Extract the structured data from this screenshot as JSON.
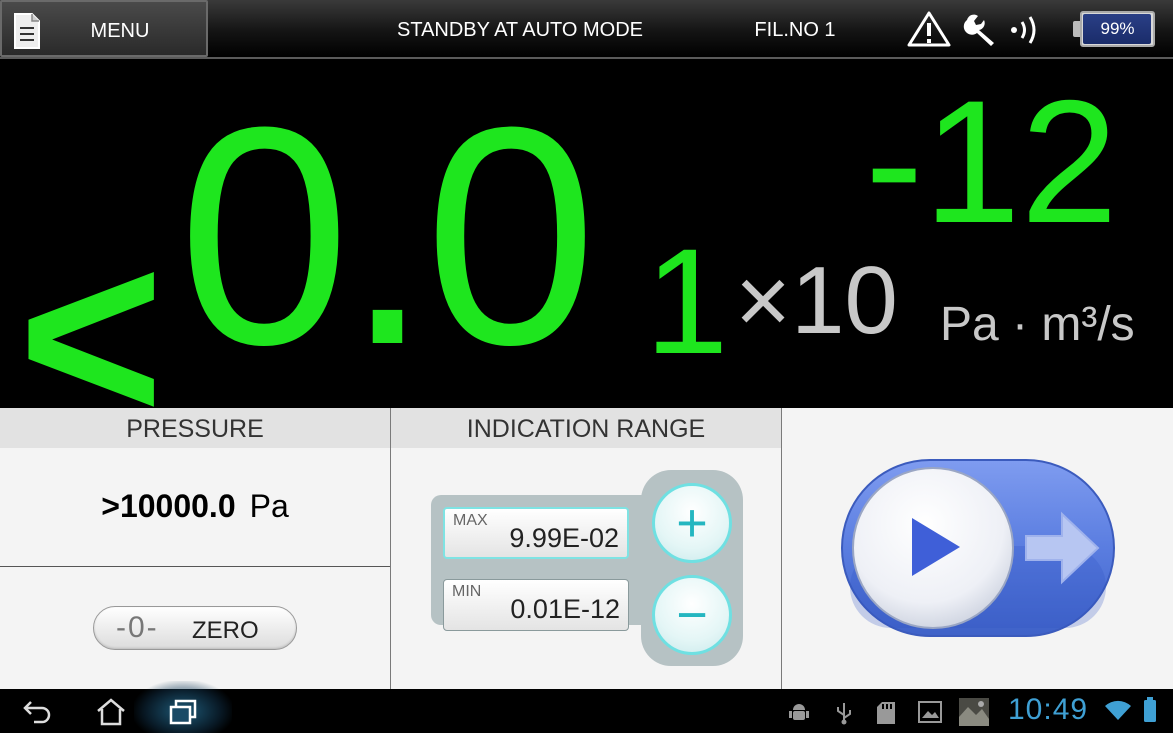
{
  "topbar": {
    "menu_label": "MENU",
    "status": "STANDBY AT AUTO MODE",
    "filament": "FIL.NO 1",
    "battery_percent": "99%",
    "battery_level": 0.99,
    "icons": [
      "document-icon",
      "warning-icon",
      "wrench-icon",
      "signal-icon",
      "battery-icon"
    ]
  },
  "readout": {
    "less_than": "<",
    "mantissa_main": "0.0",
    "mantissa_small": "1",
    "multiplier": "×10",
    "exponent": "-12",
    "unit": "Pa · m³/s",
    "color": "#1ee61e",
    "secondary_color": "#c8c8c8"
  },
  "pressure": {
    "header": "PRESSURE",
    "value": ">10000.0",
    "unit": "Pa",
    "zero_icon": "-0-",
    "zero_label": "ZERO"
  },
  "range": {
    "header": "INDICATION RANGE",
    "max_tag": "MAX",
    "max_value": "9.99E-02",
    "min_tag": "MIN",
    "min_value": "0.01E-12",
    "plus_glyph": "+",
    "minus_glyph": "−",
    "accent": "#24b6c0"
  },
  "start": {
    "icon": "play-icon",
    "arrow_icon": "arrow-right-icon",
    "accent": "#5b7fe0"
  },
  "navbar": {
    "clock": "10:49",
    "icons": [
      "back-icon",
      "home-icon",
      "recent-apps-icon",
      "android-debug-icon",
      "usb-icon",
      "sd-card-icon",
      "gallery-icon",
      "screenshot-thumb-icon",
      "wifi-icon",
      "battery-icon"
    ],
    "clock_color": "#3fa0d4"
  }
}
